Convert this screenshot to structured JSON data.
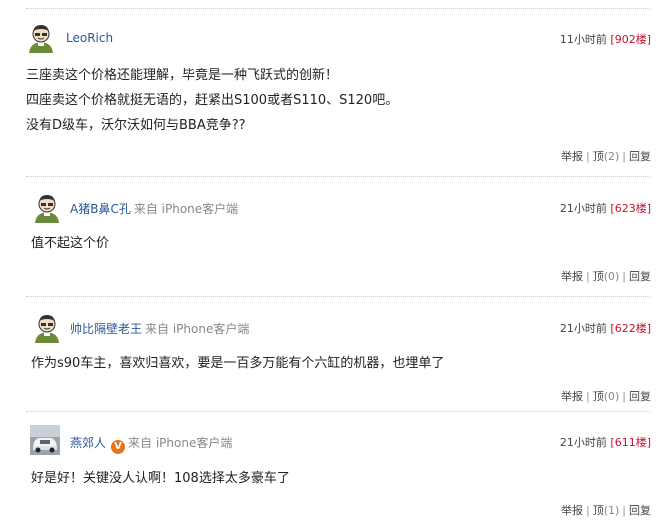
{
  "comments": [
    {
      "user": "LeoRich",
      "source": "",
      "time": "11小时前",
      "floor": "902楼",
      "lines": [
        "三座卖这个价格还能理解，毕竟是一种飞跃式的创新！",
        "四座卖这个价格就挺无语的，赶紧出S100或者S110、S120吧。",
        "没有D级车，沃尔沃如何与BBA竞争??"
      ],
      "report": "举报",
      "up": "顶",
      "up_count": "(2)",
      "reply": "回复",
      "avatar_icon": "cartoon-person-avatar-icon"
    },
    {
      "user": "A猪B鼻C孔",
      "source": "来自 iPhone客户端",
      "time": "21小时前",
      "floor": "623楼",
      "lines": [
        "值不起这个价"
      ],
      "report": "举报",
      "up": "顶",
      "up_count": "(0)",
      "reply": "回复",
      "avatar_icon": "cartoon-person-avatar-icon"
    },
    {
      "user": "帅比隔壁老王",
      "source": "来自 iPhone客户端",
      "time": "21小时前",
      "floor": "622楼",
      "lines": [
        "作为s90车主，喜欢归喜欢，要是一百多万能有个六缸的机器，也埋单了"
      ],
      "report": "举报",
      "up": "顶",
      "up_count": "(0)",
      "reply": "回复",
      "avatar_icon": "cartoon-person-avatar-icon"
    },
    {
      "user": "燕郊人",
      "badge": "V",
      "source": "来自 iPhone客户端",
      "time": "21小时前",
      "floor": "611楼",
      "lines": [
        "好是好！关键没人认啊！108选择太多豪车了"
      ],
      "report": "举报",
      "up": "顶",
      "up_count": "(1)",
      "reply": "回复",
      "avatar_icon": "car-photo-avatar-icon"
    }
  ],
  "colors": {
    "username": "#2b5797",
    "floor": "#c8102e",
    "muted": "#888888"
  }
}
